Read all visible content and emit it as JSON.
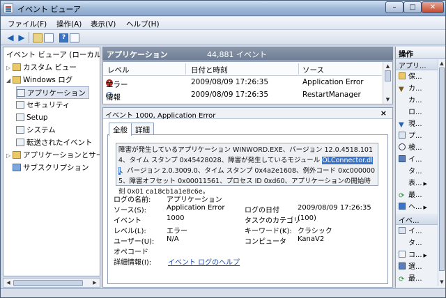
{
  "window": {
    "title": "イベント ビューア",
    "min": "–",
    "max": "□",
    "close": "✕"
  },
  "menu": [
    "ファイル(F)",
    "操作(A)",
    "表示(V)",
    "ヘルプ(H)"
  ],
  "tree": {
    "items": [
      {
        "label": "イベント ビューア (ローカル)"
      },
      {
        "label": "カスタム ビュー"
      },
      {
        "label": "Windows ログ"
      },
      {
        "label": "アプリケーション"
      },
      {
        "label": "セキュリティ"
      },
      {
        "label": "Setup"
      },
      {
        "label": "システム"
      },
      {
        "label": "転送されたイベント"
      },
      {
        "label": "アプリケーションとサービス ログ"
      },
      {
        "label": "サブスクリプション"
      }
    ]
  },
  "center": {
    "title": "アプリケーション",
    "count": "44,881 イベント"
  },
  "events": {
    "columns": [
      "レベル",
      "日付と時刻",
      "ソース"
    ],
    "rows": [
      {
        "level": "エラー",
        "datetime": "2009/08/09 17:26:35",
        "source": "Application Error"
      },
      {
        "level": "情報",
        "datetime": "2009/08/09 17:26:35",
        "source": "RestartManager"
      }
    ]
  },
  "detail": {
    "header": "イベント 1000, Application Error",
    "close": "×",
    "tabs": [
      "全般",
      "詳細"
    ],
    "message_pre": "障害が発生しているアプリケーション WINWORD.EXE、バージョン 12.0.4518.1014、タイム スタンプ 0x45428028、障害が発生しているモジュール ",
    "message_hl": "OLConnector.dll",
    "message_post": "、バージョン 2.0.3009.0、タイム スタンプ 0x4a2e1608、例外コード 0xc0000005、障害オフセット 0x00011561、プロセス ID 0xd60、アプリケーションの開始時刻 0x01 ca18cb1a1e8c6e。",
    "log_name_label": "ログの名前:",
    "log_name": "アプリケーション",
    "source_label": "ソース(S):",
    "source": "Application Error",
    "logged_label": "ログの日付",
    "logged": "2009/08/09 17:26:35",
    "event_label": "イベント",
    "event_id": "1000",
    "task_label": "タスクのカテゴリ",
    "task": "(100)",
    "level_label": "レベル(L):",
    "level": "エラー",
    "keywords_label": "キーワード(K):",
    "keywords": "クラシック",
    "user_label": "ユーザー(U):",
    "user": "N/A",
    "computer_label": "コンピュータ",
    "computer": "KanaV2",
    "opcode_label": "オペコード",
    "more_label": "詳細情報(I):",
    "more_link": "イベント ログのヘルプ"
  },
  "actions": {
    "title": "操作",
    "section1": "アプリ...",
    "items1": [
      "保...",
      "カ...",
      "カ...",
      "ロ...",
      "現...",
      "プ...",
      "検...",
      "イ...",
      "タ...",
      "表...",
      "最...",
      "ヘ..."
    ],
    "section2": "イベ...",
    "items2": [
      "イ...",
      "タ...",
      "コ...",
      "選...",
      "最..."
    ]
  }
}
